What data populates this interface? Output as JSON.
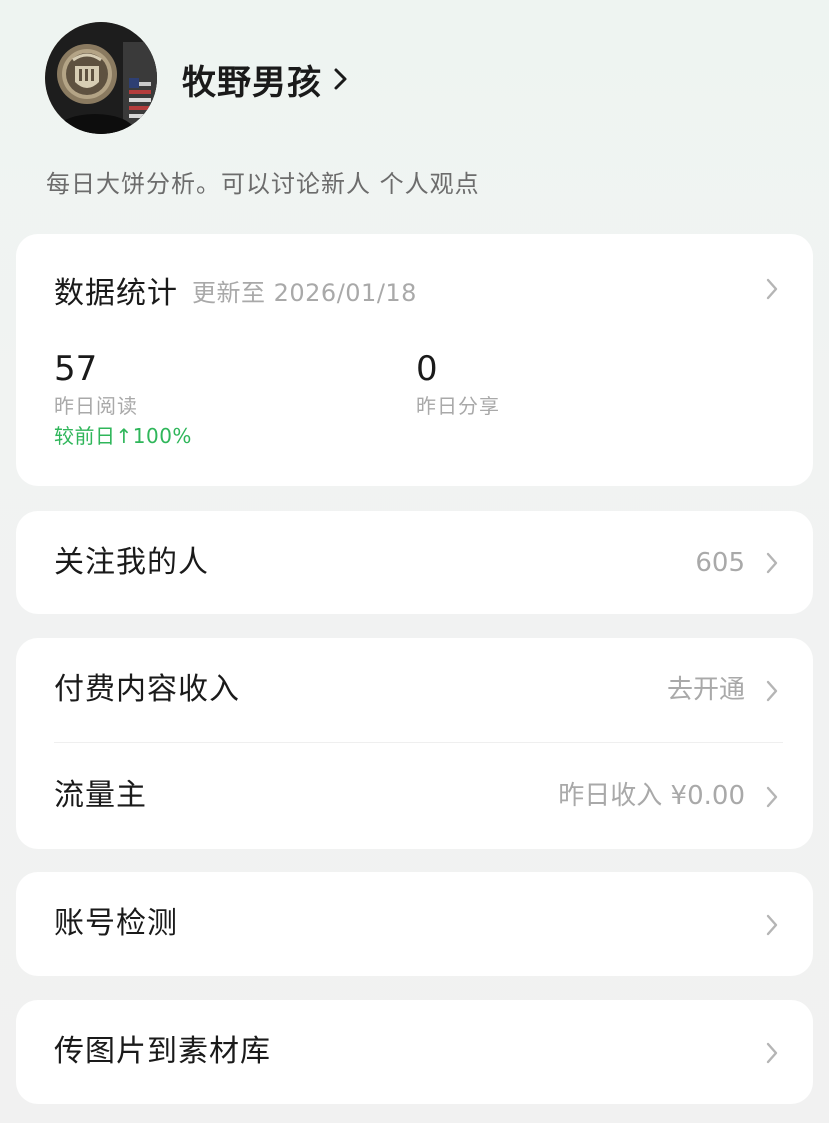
{
  "profile": {
    "name": "牧野男孩",
    "bio": "每日大饼分析。可以讨论新人 个人观点",
    "avatar_icon": "avatar-seal-icon"
  },
  "stats": {
    "title": "数据统计",
    "updated": "更新至 2026/01/18",
    "reads": {
      "value": "57",
      "label": "昨日阅读",
      "change": "较前日↑100%"
    },
    "shares": {
      "value": "0",
      "label": "昨日分享"
    }
  },
  "followers": {
    "label": "关注我的人",
    "count": "605"
  },
  "paid_income": {
    "label": "付费内容收入",
    "action": "去开通"
  },
  "traffic_owner": {
    "label": "流量主",
    "value": "昨日收入 ¥0.00"
  },
  "account_check": {
    "label": "账号检测"
  },
  "upload_images": {
    "label": "传图片到素材库"
  },
  "colors": {
    "accent_green": "#2fb65a",
    "muted_text": "#a9a9a9",
    "card_bg": "#ffffff",
    "page_bg": "#f1f3f2"
  }
}
